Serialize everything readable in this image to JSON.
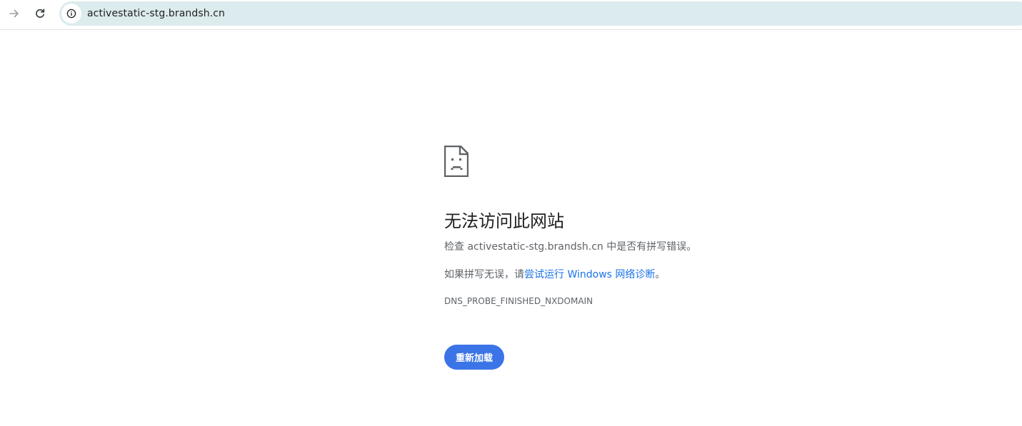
{
  "browser": {
    "url": "activestatic-stg.brandsh.cn",
    "icons": {
      "forward": "arrow-right-icon",
      "reload": "reload-icon",
      "site_info": "info-icon"
    }
  },
  "error": {
    "icon": "sad-document-icon",
    "title": "无法访问此网站",
    "check_prefix": "检查 ",
    "check_domain": "activestatic-stg.brandsh.cn",
    "check_suffix": " 中是否有拼写错误。",
    "suggest_prefix": "如果拼写无误，请",
    "suggest_link": "尝试运行 Windows 网络诊断",
    "suggest_suffix": "。",
    "code": "DNS_PROBE_FINISHED_NXDOMAIN",
    "reload_label": "重新加载"
  },
  "colors": {
    "omnibox_bg": "#dcebed",
    "link": "#1a73e8",
    "button_bg": "#3b74e6",
    "text_secondary": "#5f6368",
    "title": "#202124"
  }
}
